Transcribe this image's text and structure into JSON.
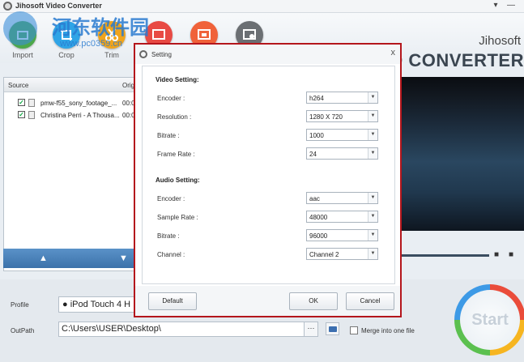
{
  "window": {
    "title": "Jihosoft Video Converter",
    "buttons": [
      "▾",
      "—"
    ]
  },
  "toolbar": {
    "items": [
      {
        "label": "Import",
        "color": "#4ca84a"
      },
      {
        "label": "Crop",
        "color": "#2fa4e6"
      },
      {
        "label": "Trim",
        "color": "#f0a41c"
      },
      {
        "label": "",
        "color": "#e84a44"
      },
      {
        "label": "",
        "color": "#f0623a"
      },
      {
        "label": "",
        "color": "#6b6f73"
      }
    ],
    "brand_small": "Jihosoft",
    "brand_big": "VIDEO CONVERTER"
  },
  "watermark": {
    "line1": "河东软件园",
    "line2": "www.pc0359.cn"
  },
  "source_list": {
    "header_source": "Source",
    "header_orig": "Origi",
    "files": [
      {
        "name": "pmw-f55_sony_footage_...",
        "duration": "00:0",
        "checked": true
      },
      {
        "name": "Christina Perri - A Thousa...",
        "duration": "00:0",
        "checked": true
      }
    ],
    "up_icon": "▲",
    "down_icon": "▼"
  },
  "player": {
    "camera_icon": "📷"
  },
  "bottom": {
    "profile_label": "Profile",
    "profile_value": "iPod Touch 4 H",
    "outpath_label": "OutPath",
    "outpath_value": "C:\\Users\\USER\\Desktop\\",
    "browse_label": "···",
    "merge_label": "Merge into one file",
    "start_label": "Start"
  },
  "dialog": {
    "title": "Setting",
    "close": "x",
    "video_section": "Video Setting:",
    "audio_section": "Audio Setting:",
    "video_fields": [
      {
        "label": "Encoder :",
        "value": "h264"
      },
      {
        "label": "Resolution :",
        "value": "1280 X 720"
      },
      {
        "label": "Bitrate :",
        "value": "1000"
      },
      {
        "label": "Frame Rate :",
        "value": "24"
      }
    ],
    "audio_fields": [
      {
        "label": "Encoder :",
        "value": "aac"
      },
      {
        "label": "Sample Rate :",
        "value": "48000"
      },
      {
        "label": "Bitrate :",
        "value": "96000"
      },
      {
        "label": "Channel :",
        "value": "Channel 2"
      }
    ],
    "default_label": "Default",
    "ok_label": "OK",
    "cancel_label": "Cancel"
  }
}
